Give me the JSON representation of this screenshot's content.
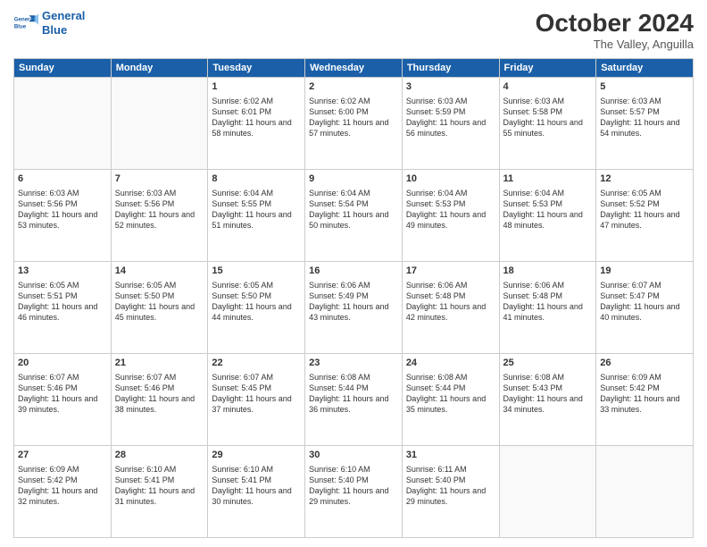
{
  "header": {
    "logo_line1": "General",
    "logo_line2": "Blue",
    "month": "October 2024",
    "location": "The Valley, Anguilla"
  },
  "weekdays": [
    "Sunday",
    "Monday",
    "Tuesday",
    "Wednesday",
    "Thursday",
    "Friday",
    "Saturday"
  ],
  "weeks": [
    [
      {
        "day": "",
        "empty": true
      },
      {
        "day": "",
        "empty": true
      },
      {
        "day": "1",
        "info": "Sunrise: 6:02 AM\nSunset: 6:01 PM\nDaylight: 11 hours and 58 minutes."
      },
      {
        "day": "2",
        "info": "Sunrise: 6:02 AM\nSunset: 6:00 PM\nDaylight: 11 hours and 57 minutes."
      },
      {
        "day": "3",
        "info": "Sunrise: 6:03 AM\nSunset: 5:59 PM\nDaylight: 11 hours and 56 minutes."
      },
      {
        "day": "4",
        "info": "Sunrise: 6:03 AM\nSunset: 5:58 PM\nDaylight: 11 hours and 55 minutes."
      },
      {
        "day": "5",
        "info": "Sunrise: 6:03 AM\nSunset: 5:57 PM\nDaylight: 11 hours and 54 minutes."
      }
    ],
    [
      {
        "day": "6",
        "info": "Sunrise: 6:03 AM\nSunset: 5:56 PM\nDaylight: 11 hours and 53 minutes."
      },
      {
        "day": "7",
        "info": "Sunrise: 6:03 AM\nSunset: 5:56 PM\nDaylight: 11 hours and 52 minutes."
      },
      {
        "day": "8",
        "info": "Sunrise: 6:04 AM\nSunset: 5:55 PM\nDaylight: 11 hours and 51 minutes."
      },
      {
        "day": "9",
        "info": "Sunrise: 6:04 AM\nSunset: 5:54 PM\nDaylight: 11 hours and 50 minutes."
      },
      {
        "day": "10",
        "info": "Sunrise: 6:04 AM\nSunset: 5:53 PM\nDaylight: 11 hours and 49 minutes."
      },
      {
        "day": "11",
        "info": "Sunrise: 6:04 AM\nSunset: 5:53 PM\nDaylight: 11 hours and 48 minutes."
      },
      {
        "day": "12",
        "info": "Sunrise: 6:05 AM\nSunset: 5:52 PM\nDaylight: 11 hours and 47 minutes."
      }
    ],
    [
      {
        "day": "13",
        "info": "Sunrise: 6:05 AM\nSunset: 5:51 PM\nDaylight: 11 hours and 46 minutes."
      },
      {
        "day": "14",
        "info": "Sunrise: 6:05 AM\nSunset: 5:50 PM\nDaylight: 11 hours and 45 minutes."
      },
      {
        "day": "15",
        "info": "Sunrise: 6:05 AM\nSunset: 5:50 PM\nDaylight: 11 hours and 44 minutes."
      },
      {
        "day": "16",
        "info": "Sunrise: 6:06 AM\nSunset: 5:49 PM\nDaylight: 11 hours and 43 minutes."
      },
      {
        "day": "17",
        "info": "Sunrise: 6:06 AM\nSunset: 5:48 PM\nDaylight: 11 hours and 42 minutes."
      },
      {
        "day": "18",
        "info": "Sunrise: 6:06 AM\nSunset: 5:48 PM\nDaylight: 11 hours and 41 minutes."
      },
      {
        "day": "19",
        "info": "Sunrise: 6:07 AM\nSunset: 5:47 PM\nDaylight: 11 hours and 40 minutes."
      }
    ],
    [
      {
        "day": "20",
        "info": "Sunrise: 6:07 AM\nSunset: 5:46 PM\nDaylight: 11 hours and 39 minutes."
      },
      {
        "day": "21",
        "info": "Sunrise: 6:07 AM\nSunset: 5:46 PM\nDaylight: 11 hours and 38 minutes."
      },
      {
        "day": "22",
        "info": "Sunrise: 6:07 AM\nSunset: 5:45 PM\nDaylight: 11 hours and 37 minutes."
      },
      {
        "day": "23",
        "info": "Sunrise: 6:08 AM\nSunset: 5:44 PM\nDaylight: 11 hours and 36 minutes."
      },
      {
        "day": "24",
        "info": "Sunrise: 6:08 AM\nSunset: 5:44 PM\nDaylight: 11 hours and 35 minutes."
      },
      {
        "day": "25",
        "info": "Sunrise: 6:08 AM\nSunset: 5:43 PM\nDaylight: 11 hours and 34 minutes."
      },
      {
        "day": "26",
        "info": "Sunrise: 6:09 AM\nSunset: 5:42 PM\nDaylight: 11 hours and 33 minutes."
      }
    ],
    [
      {
        "day": "27",
        "info": "Sunrise: 6:09 AM\nSunset: 5:42 PM\nDaylight: 11 hours and 32 minutes."
      },
      {
        "day": "28",
        "info": "Sunrise: 6:10 AM\nSunset: 5:41 PM\nDaylight: 11 hours and 31 minutes."
      },
      {
        "day": "29",
        "info": "Sunrise: 6:10 AM\nSunset: 5:41 PM\nDaylight: 11 hours and 30 minutes."
      },
      {
        "day": "30",
        "info": "Sunrise: 6:10 AM\nSunset: 5:40 PM\nDaylight: 11 hours and 29 minutes."
      },
      {
        "day": "31",
        "info": "Sunrise: 6:11 AM\nSunset: 5:40 PM\nDaylight: 11 hours and 29 minutes."
      },
      {
        "day": "",
        "empty": true
      },
      {
        "day": "",
        "empty": true
      }
    ]
  ]
}
